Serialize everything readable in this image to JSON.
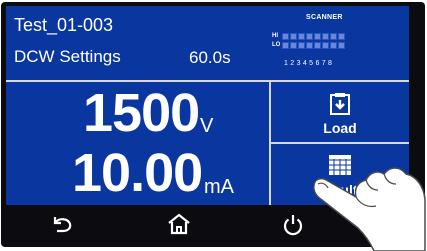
{
  "header": {
    "test_name": "Test_01-003",
    "mode": "DCW Settings",
    "time": "60.0s"
  },
  "scanner": {
    "title": "SCANNER",
    "hi_label": "HI",
    "lo_label": "LO",
    "channels": "12345678"
  },
  "readings": {
    "voltage": "1500",
    "voltage_unit": "V",
    "current": "10.00",
    "current_unit": "mA"
  },
  "side_buttons": {
    "load_label": "Load",
    "results_label": "Results"
  },
  "icons": {
    "load": "load-icon",
    "results": "results-grid-icon",
    "back": "back-arrow-icon",
    "home": "home-icon",
    "power": "power-icon"
  },
  "colors": {
    "screen_bg": "#0a36a0",
    "bezel": "#0c0c10",
    "text": "#ffffff"
  }
}
